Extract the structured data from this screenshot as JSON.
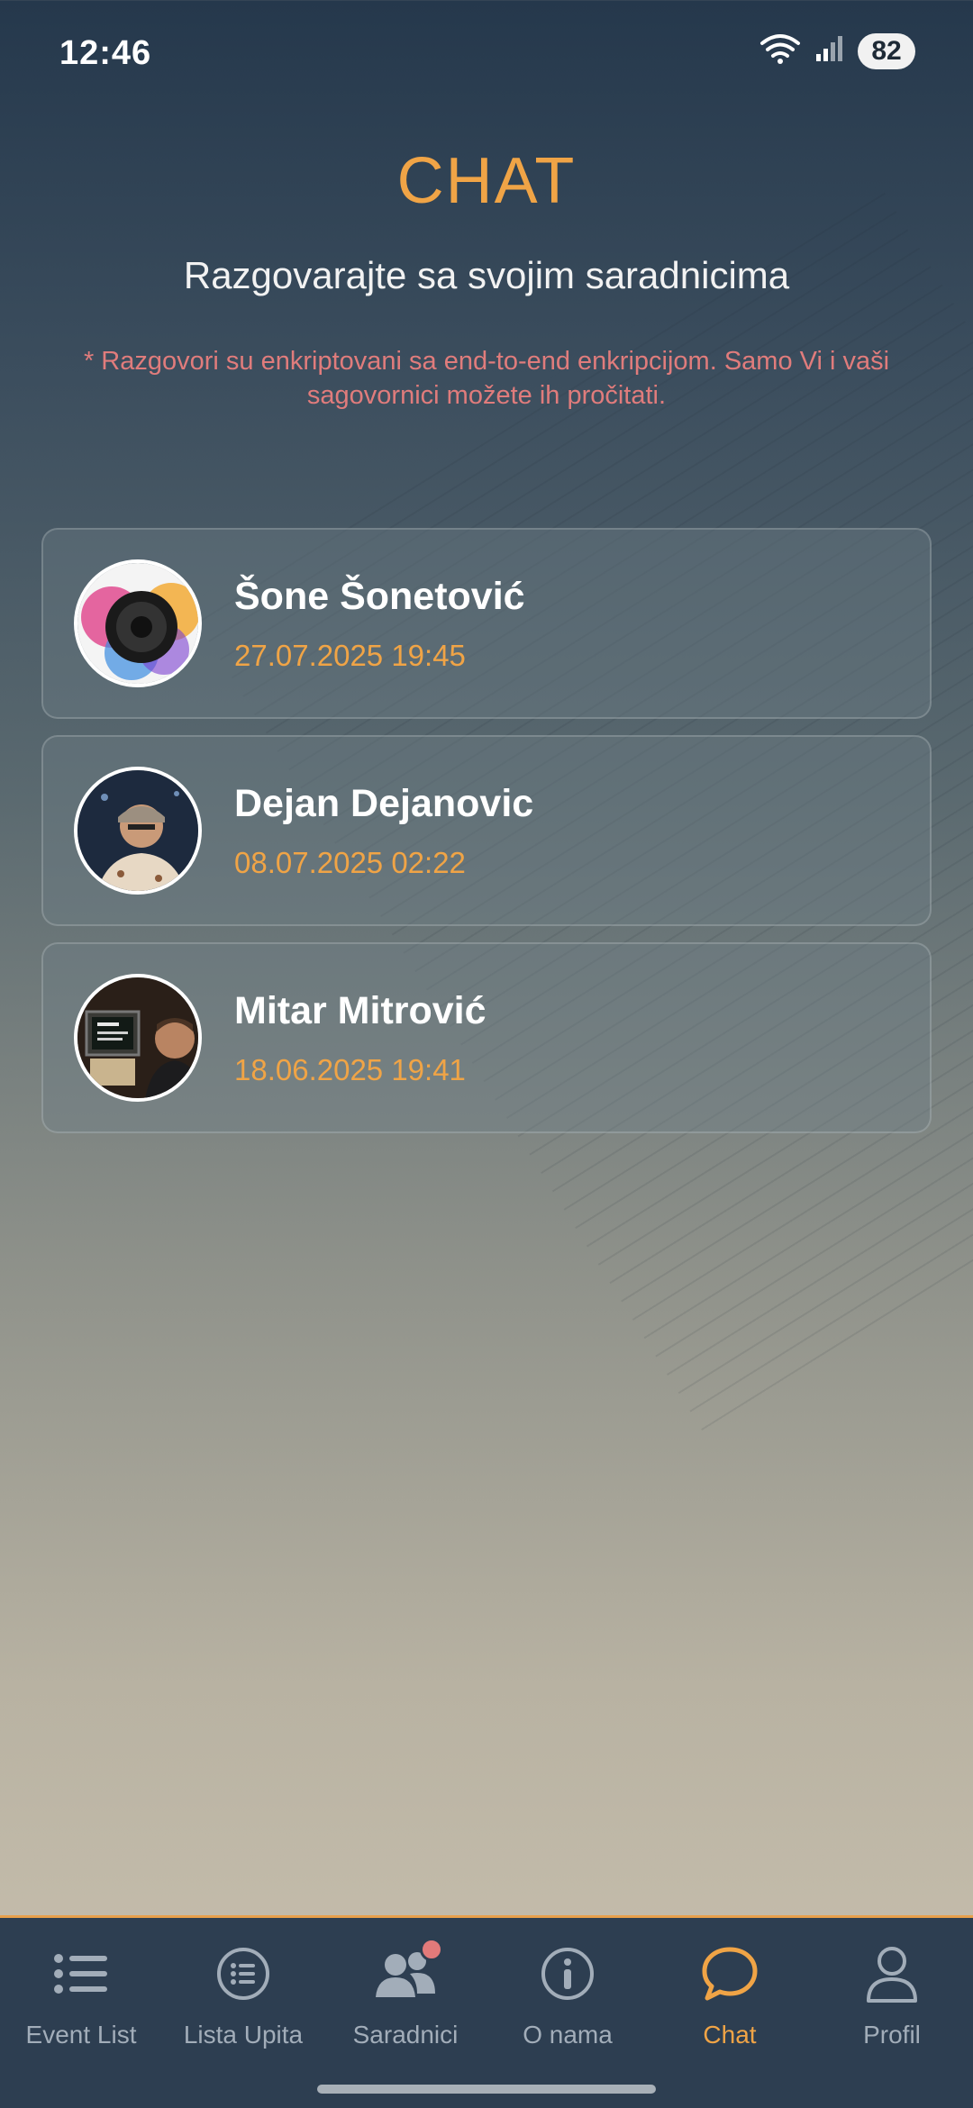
{
  "status_bar": {
    "time": "12:46",
    "battery": "82"
  },
  "header": {
    "title": "CHAT",
    "subtitle": "Razgovarajte sa svojim saradnicima",
    "notice": "* Razgovori su enkriptovani sa end-to-end enkripcijom. Samo Vi i vaši sagovornici možete ih pročitati."
  },
  "chats": [
    {
      "name": "Šone Šonetović",
      "date": "27.07.2025 19:45",
      "avatar": "speaker-avatar"
    },
    {
      "name": "Dejan Dejanovic",
      "date": "08.07.2025 02:22",
      "avatar": "man-with-cap-avatar"
    },
    {
      "name": "Mitar Mitrović",
      "date": "18.06.2025 19:41",
      "avatar": "man-with-computer-avatar"
    }
  ],
  "bottom_nav": {
    "items": [
      {
        "label": "Event List",
        "icon": "list-icon"
      },
      {
        "label": "Lista Upita",
        "icon": "list-circle-icon"
      },
      {
        "label": "Saradnici",
        "icon": "people-icon",
        "badge": true
      },
      {
        "label": "O nama",
        "icon": "info-icon"
      },
      {
        "label": "Chat",
        "icon": "chat-bubble-icon",
        "active": true
      },
      {
        "label": "Profil",
        "icon": "user-icon"
      }
    ]
  },
  "colors": {
    "accent": "#f0a446",
    "notice": "#e07c7c",
    "nav_bg": "#2d3e51"
  }
}
